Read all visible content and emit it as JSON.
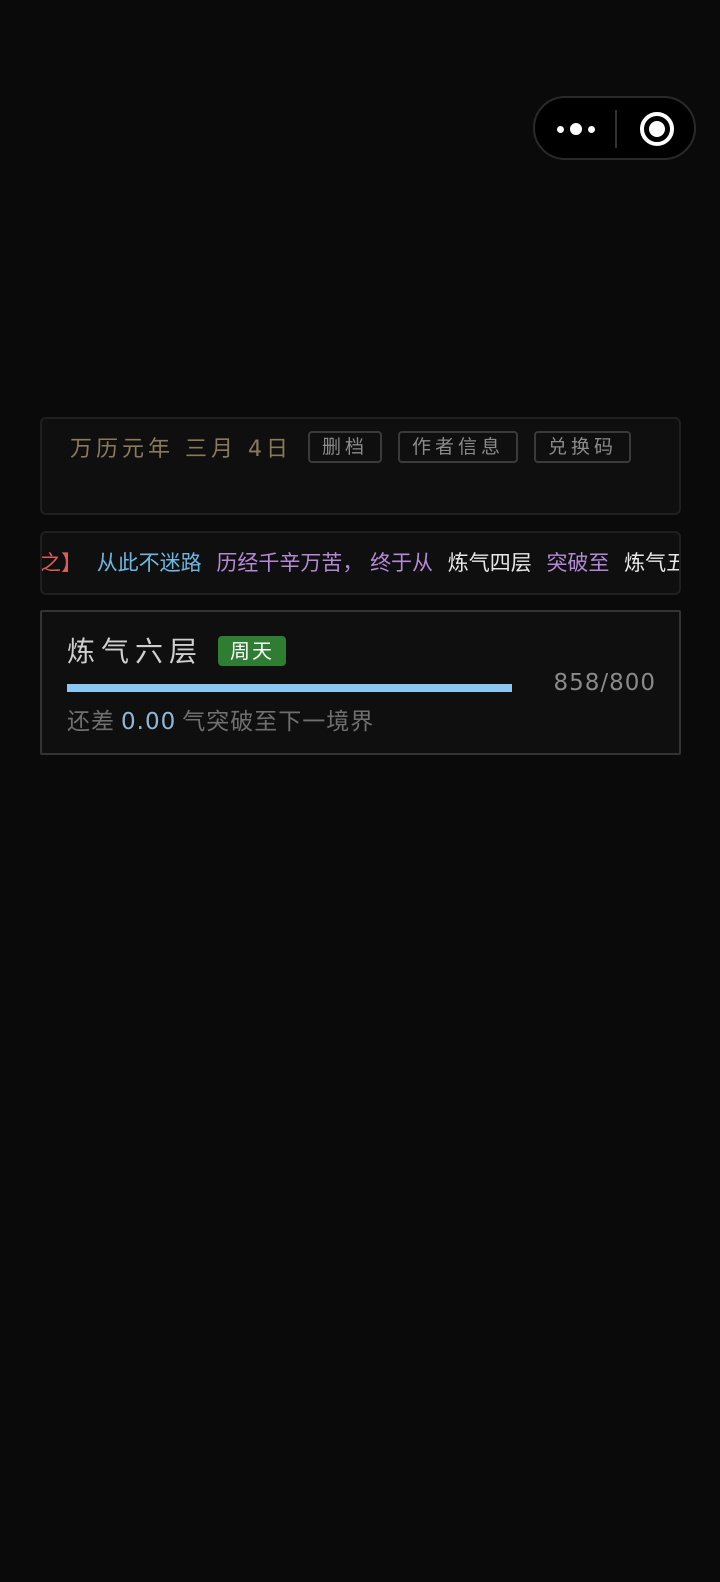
{
  "header": {
    "date": "万历元年 三月 4日",
    "buttons": {
      "delete": "删档",
      "author": "作者信息",
      "redeem": "兑换码"
    }
  },
  "log": {
    "segments": [
      {
        "text": "之】",
        "color": "#e05a5a"
      },
      {
        "text": "从此不迷路",
        "color": "#6fb6e0"
      },
      {
        "text": "历经千辛万苦，",
        "color": "#b48ad8"
      },
      {
        "text": "终于从",
        "color": "#b48ad8"
      },
      {
        "text": "炼气四层",
        "color": "#e8e8e8"
      },
      {
        "text": "突破至",
        "color": "#b48ad8"
      },
      {
        "text": "炼气五层",
        "color": "#e8e8e8"
      }
    ]
  },
  "realm": {
    "name": "炼气六层",
    "badge": "周天",
    "badge_color": "#2e7d32",
    "progress_text": "858/800",
    "progress_fraction": 1.0,
    "bar_color": "#8ac7f4",
    "remain_prefix": "还差",
    "remain_value": "0.00",
    "remain_suffix": "气突破至下一境界"
  }
}
